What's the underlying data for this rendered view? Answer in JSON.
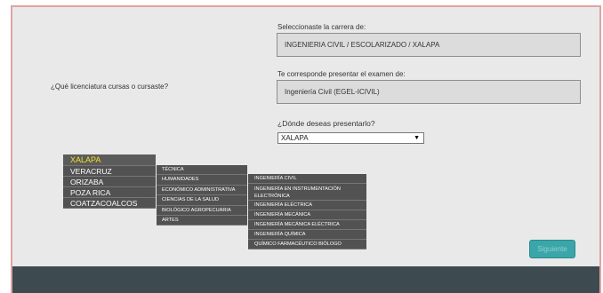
{
  "question_left": "¿Qué licenciatura cursas o cursaste?",
  "career": {
    "label": "Seleccionaste la carrera de:",
    "value": "INGENIERIA CIVIL / ESCOLARIZADO / XALAPA"
  },
  "exam": {
    "label": "Te corresponde presentar el examen de:",
    "value": "Ingeniería Civil (EGEL-ICIVIL)"
  },
  "location": {
    "label": "¿Dónde deseas presentarlo?",
    "selected": "XALAPA"
  },
  "cities": [
    "XALAPA",
    "VERACRUZ",
    "ORIZABA",
    "POZA RICA",
    "COATZACOALCOS"
  ],
  "areas": [
    "TÉCNICA",
    "HUMANIDADES",
    "ECONÓMICO ADMINISTRATIVA",
    "CIENCIAS DE LA SALUD",
    "BIOLÓGICO AGROPECUARIA",
    "ARTES"
  ],
  "careers": [
    "INGENIERÍA CIVIL",
    "INGENIERÍA EN INSTRUMENTACIÓN ELECTRÓNICA",
    "INGENIERÍA ELÉCTRICA",
    "INGENIERÍA MECÁNICA",
    "INGENIERÍA MECÁNICA ELÉCTRICA",
    "INGENIERÍA QUÍMICA",
    "QUÍMICO FARMACÉUTICO BIÓLOGO"
  ],
  "next_button": "Siguiente",
  "colors": {
    "accent": "#3aa6a9",
    "active_menu_text": "#f2e02a",
    "footer": "#3d4a50"
  }
}
